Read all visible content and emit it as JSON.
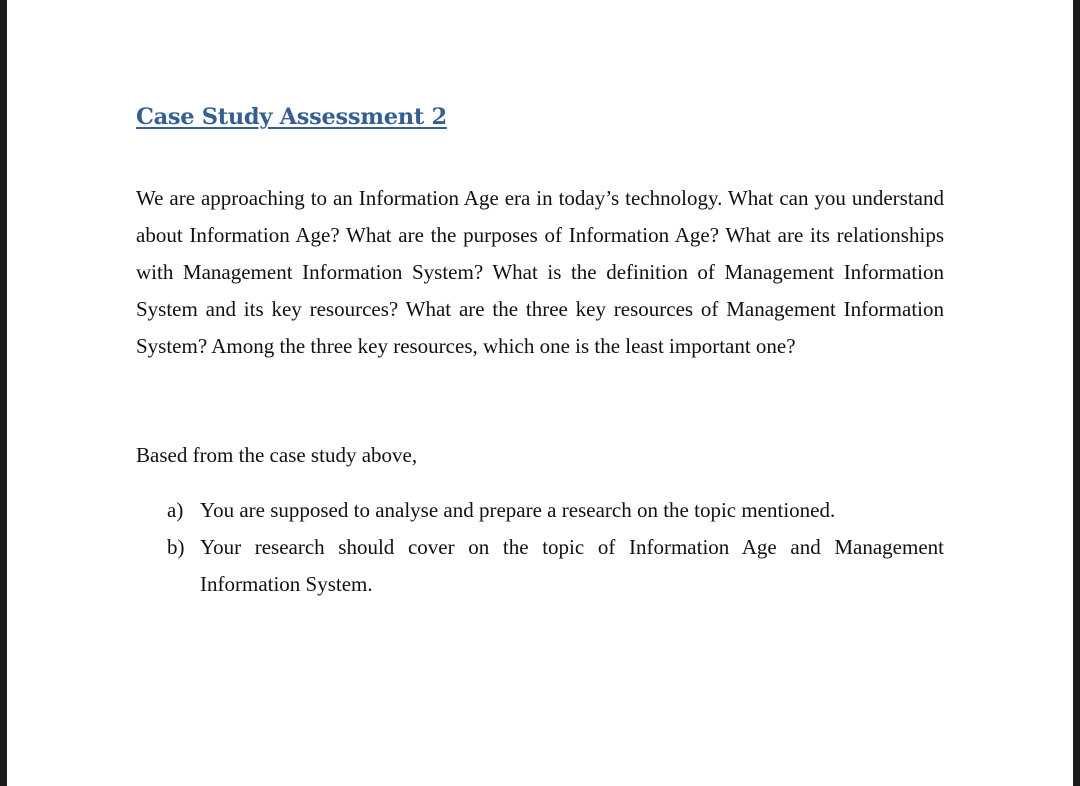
{
  "document": {
    "title": "Case Study Assessment 2",
    "paragraph": "We are approaching to an Information Age era in today’s technology.  What can you understand about Information Age?  What are the purposes of Information Age?  What are its relationships with Management Information System?  What is the definition of Management Information System and its key resources?  What are the three key resources of Management Information System?  Among the three key resources, which one is the least important one?",
    "intro": "Based from the case study above,",
    "list_items": [
      {
        "marker": "a)",
        "text": "You are supposed to analyse and prepare a research on the topic mentioned."
      },
      {
        "marker": "b)",
        "text": "Your research should cover on the topic of Information Age and Management Information System."
      }
    ]
  },
  "colors": {
    "title": "#365f91",
    "body_text": "#111111",
    "page": "#ffffff",
    "frame": "#1c1c1c"
  }
}
